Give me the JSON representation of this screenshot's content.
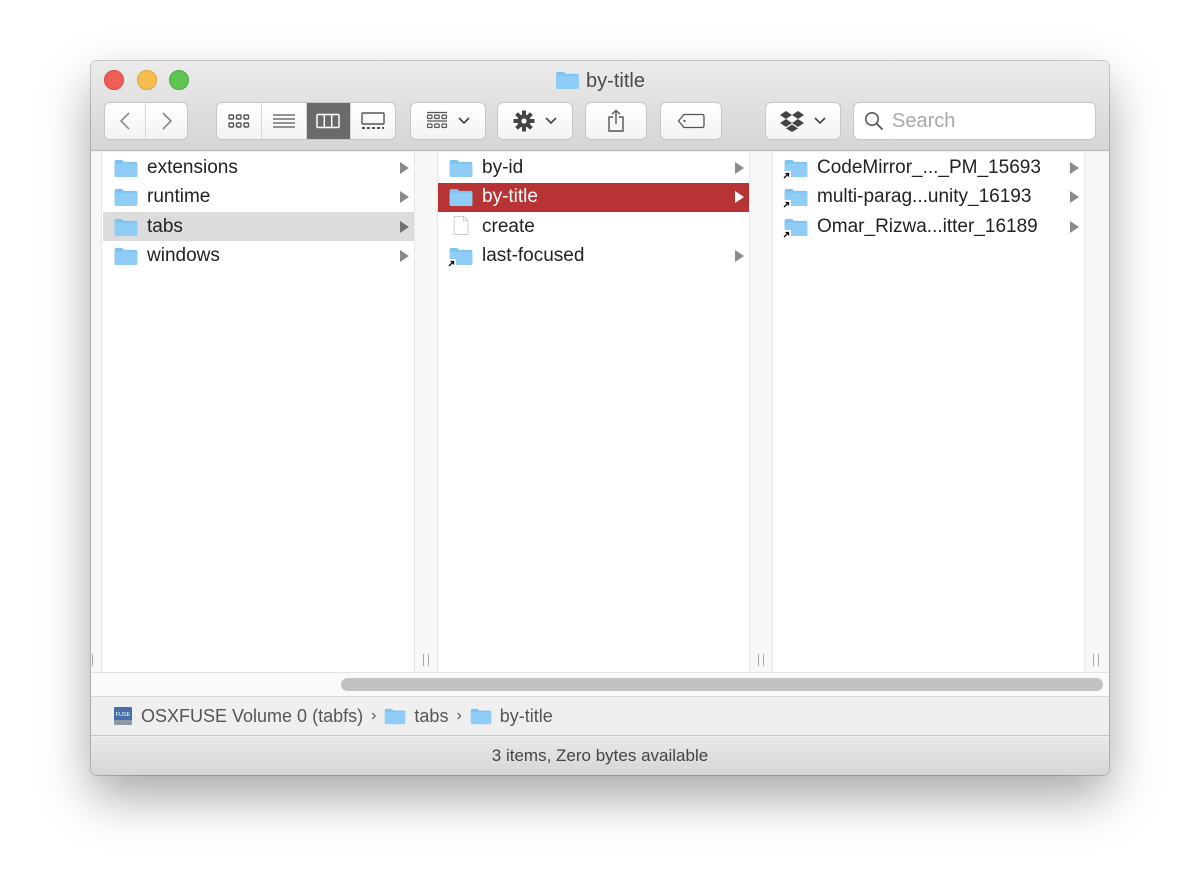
{
  "window": {
    "title": "by-title"
  },
  "toolbar": {
    "back": "back",
    "forward": "forward",
    "views": [
      {
        "name": "icon-view",
        "active": false
      },
      {
        "name": "list-view",
        "active": false
      },
      {
        "name": "column-view",
        "active": true
      },
      {
        "name": "gallery-view",
        "active": false
      }
    ],
    "group_menu": "group-by",
    "action_menu": "action",
    "share": "share",
    "tags": "tags",
    "dropbox_menu": "dropbox",
    "search_placeholder": "Search"
  },
  "columns": [
    {
      "items": [
        {
          "name": "extensions",
          "type": "folder",
          "alias": false,
          "has_children": true,
          "selected": false
        },
        {
          "name": "runtime",
          "type": "folder",
          "alias": false,
          "has_children": true,
          "selected": false
        },
        {
          "name": "tabs",
          "type": "folder",
          "alias": false,
          "has_children": true,
          "selected": "inactive"
        },
        {
          "name": "windows",
          "type": "folder",
          "alias": false,
          "has_children": true,
          "selected": false
        }
      ]
    },
    {
      "items": [
        {
          "name": "by-id",
          "type": "folder",
          "alias": false,
          "has_children": true,
          "selected": false
        },
        {
          "name": "by-title",
          "type": "folder",
          "alias": false,
          "has_children": true,
          "selected": "active"
        },
        {
          "name": "create",
          "type": "file",
          "alias": false,
          "has_children": false,
          "selected": false
        },
        {
          "name": "last-focused",
          "type": "folder",
          "alias": true,
          "has_children": true,
          "selected": false
        }
      ]
    },
    {
      "items": [
        {
          "name": "CodeMirror_..._PM_15693",
          "type": "folder",
          "alias": true,
          "has_children": true,
          "selected": false
        },
        {
          "name": "multi-parag...unity_16193",
          "type": "folder",
          "alias": true,
          "has_children": true,
          "selected": false
        },
        {
          "name": "Omar_Rizwa...itter_16189",
          "type": "folder",
          "alias": true,
          "has_children": true,
          "selected": false
        }
      ]
    }
  ],
  "pathbar": {
    "volume": "OSXFUSE Volume 0 (tabfs)",
    "volume_badge": "FUSE",
    "items": [
      "tabs",
      "by-title"
    ],
    "separator": "›"
  },
  "status": "3 items, Zero bytes available",
  "colors": {
    "selection_active": "#b83434",
    "selection_inactive": "#dcdcdc",
    "folder": "#7cc3f3"
  }
}
